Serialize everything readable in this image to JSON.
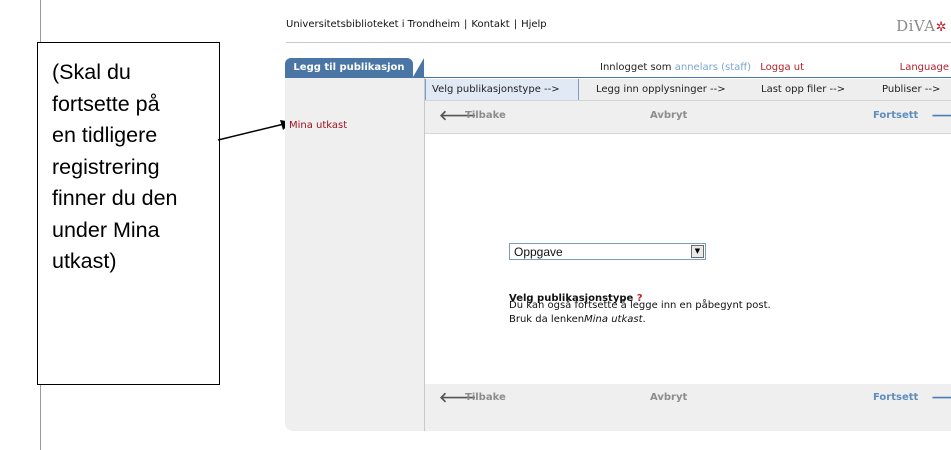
{
  "callout": {
    "lines": [
      "(Skal du",
      "fortsette på",
      "en tidligere",
      "registrering",
      "finner du den",
      "under Mina",
      "utkast)"
    ]
  },
  "header": {
    "links": [
      "Universitetsbiblioteket i Trondheim",
      "Kontakt",
      "Hjelp"
    ],
    "logo": "DiVA",
    "logo_star": "✲"
  },
  "tab": {
    "label": "Legg til publikasjon"
  },
  "login": {
    "prefix": "Innlogget som",
    "user": "annelars (staff)",
    "logout": "Logga ut",
    "language": "Language"
  },
  "sidebar": {
    "drafts_link": "Mina utkast"
  },
  "steps": [
    "Velg publikasjonstype -->",
    "Legg inn opplysninger -->",
    "Last opp filer -->",
    "Publiser -->"
  ],
  "nav": {
    "back": "Tilbake",
    "cancel": "Avbryt",
    "forward": "Fortsett"
  },
  "form": {
    "label": "Velg publikasjonstype",
    "help": "?",
    "selected": "Oppgave",
    "info_line1": "Du kan også fortsette å legge inn en påbegynt post.",
    "info_line2_prefix": "Bruk da lenken",
    "info_line2_link": "Mina utkast",
    "info_line2_suffix": "."
  },
  "colors": {
    "tab_blue": "#4a76a6",
    "link_red": "#b21e2c",
    "forward_blue": "#4d7fb5",
    "panel_gray": "#efefef"
  },
  "icons": {
    "back": "arrow-left-icon",
    "forward": "arrow-right-icon",
    "dropdown": "chevron-down-icon"
  }
}
